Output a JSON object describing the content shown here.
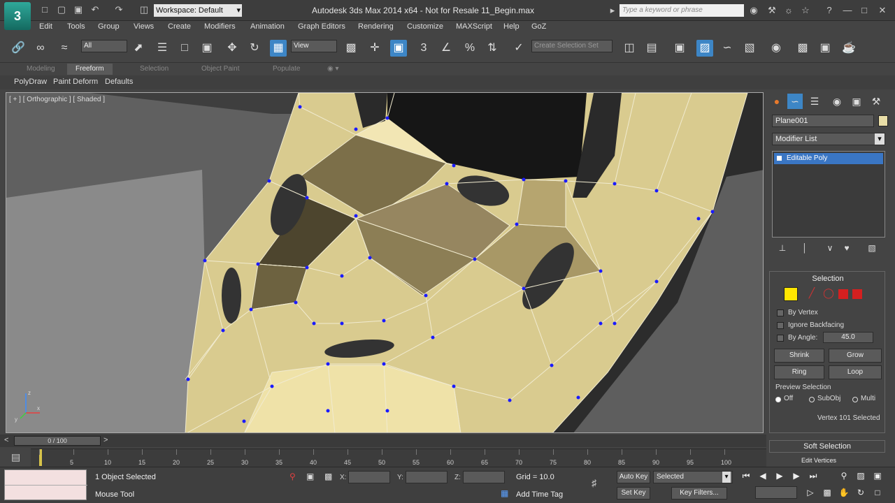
{
  "app": {
    "logo": "3",
    "workspace": "Workspace: Default",
    "window_title": "Autodesk 3ds Max 2014 x64  - Not for Resale   11_Begin.max",
    "search_placeholder": "Type a keyword or phrase"
  },
  "menu": [
    "Edit",
    "Tools",
    "Group",
    "Views",
    "Create",
    "Modifiers",
    "Animation",
    "Graph Editors",
    "Rendering",
    "Customize",
    "MAXScript",
    "Help",
    "GoZ"
  ],
  "toolbar": {
    "selection_filter": "All",
    "ref_coord": "View",
    "named_selection": "Create Selection Set",
    "snap_label": "3"
  },
  "ribbon": {
    "tabs": [
      "Modeling",
      "Freeform",
      "Selection",
      "Object Paint",
      "Populate"
    ],
    "active_tab": "Freeform",
    "panels": [
      "PolyDraw",
      "Paint Deform",
      "Defaults"
    ]
  },
  "viewport": {
    "label": "[ + ] [ Orthographic ] [ Shaded ]",
    "axis_x": "x",
    "axis_y": "y",
    "axis_z": "z"
  },
  "command_panel": {
    "object_name": "Plane001",
    "object_color": "#e8dda6",
    "modifier_list": "Modifier List",
    "stack_item": "Editable Poly",
    "selection": {
      "title": "Selection",
      "by_vertex": "By Vertex",
      "ignore_backfacing": "Ignore Backfacing",
      "by_angle": "By Angle:",
      "angle_value": "45.0",
      "shrink": "Shrink",
      "grow": "Grow",
      "ring": "Ring",
      "loop": "Loop",
      "preview_title": "Preview Selection",
      "preview_off": "Off",
      "preview_subobj": "SubObj",
      "preview_multi": "Multi",
      "status": "Vertex 101 Selected"
    },
    "soft_selection": "Soft Selection",
    "edit_vertices": "Edit Vertices"
  },
  "timeline": {
    "position": "0 / 100",
    "frames": [
      "0",
      "5",
      "10",
      "15",
      "20",
      "25",
      "30",
      "35",
      "40",
      "45",
      "50",
      "55",
      "60",
      "65",
      "70",
      "75",
      "80",
      "85",
      "90",
      "95",
      "100"
    ]
  },
  "status": {
    "selection_info": "1 Object Selected",
    "prompt": "Mouse Tool",
    "x_label": "X:",
    "y_label": "Y:",
    "z_label": "Z:",
    "grid": "Grid = 10.0",
    "add_time_tag": "Add Time Tag",
    "auto_key": "Auto Key",
    "set_key": "Set Key",
    "selected": "Selected",
    "key_filters": "Key Filters..."
  },
  "colors": {
    "mesh_fill": "#d9cb8f",
    "mesh_dark": "#7c6f49",
    "vertex": "#1a1aff",
    "active_blue": "#3d86c6"
  }
}
